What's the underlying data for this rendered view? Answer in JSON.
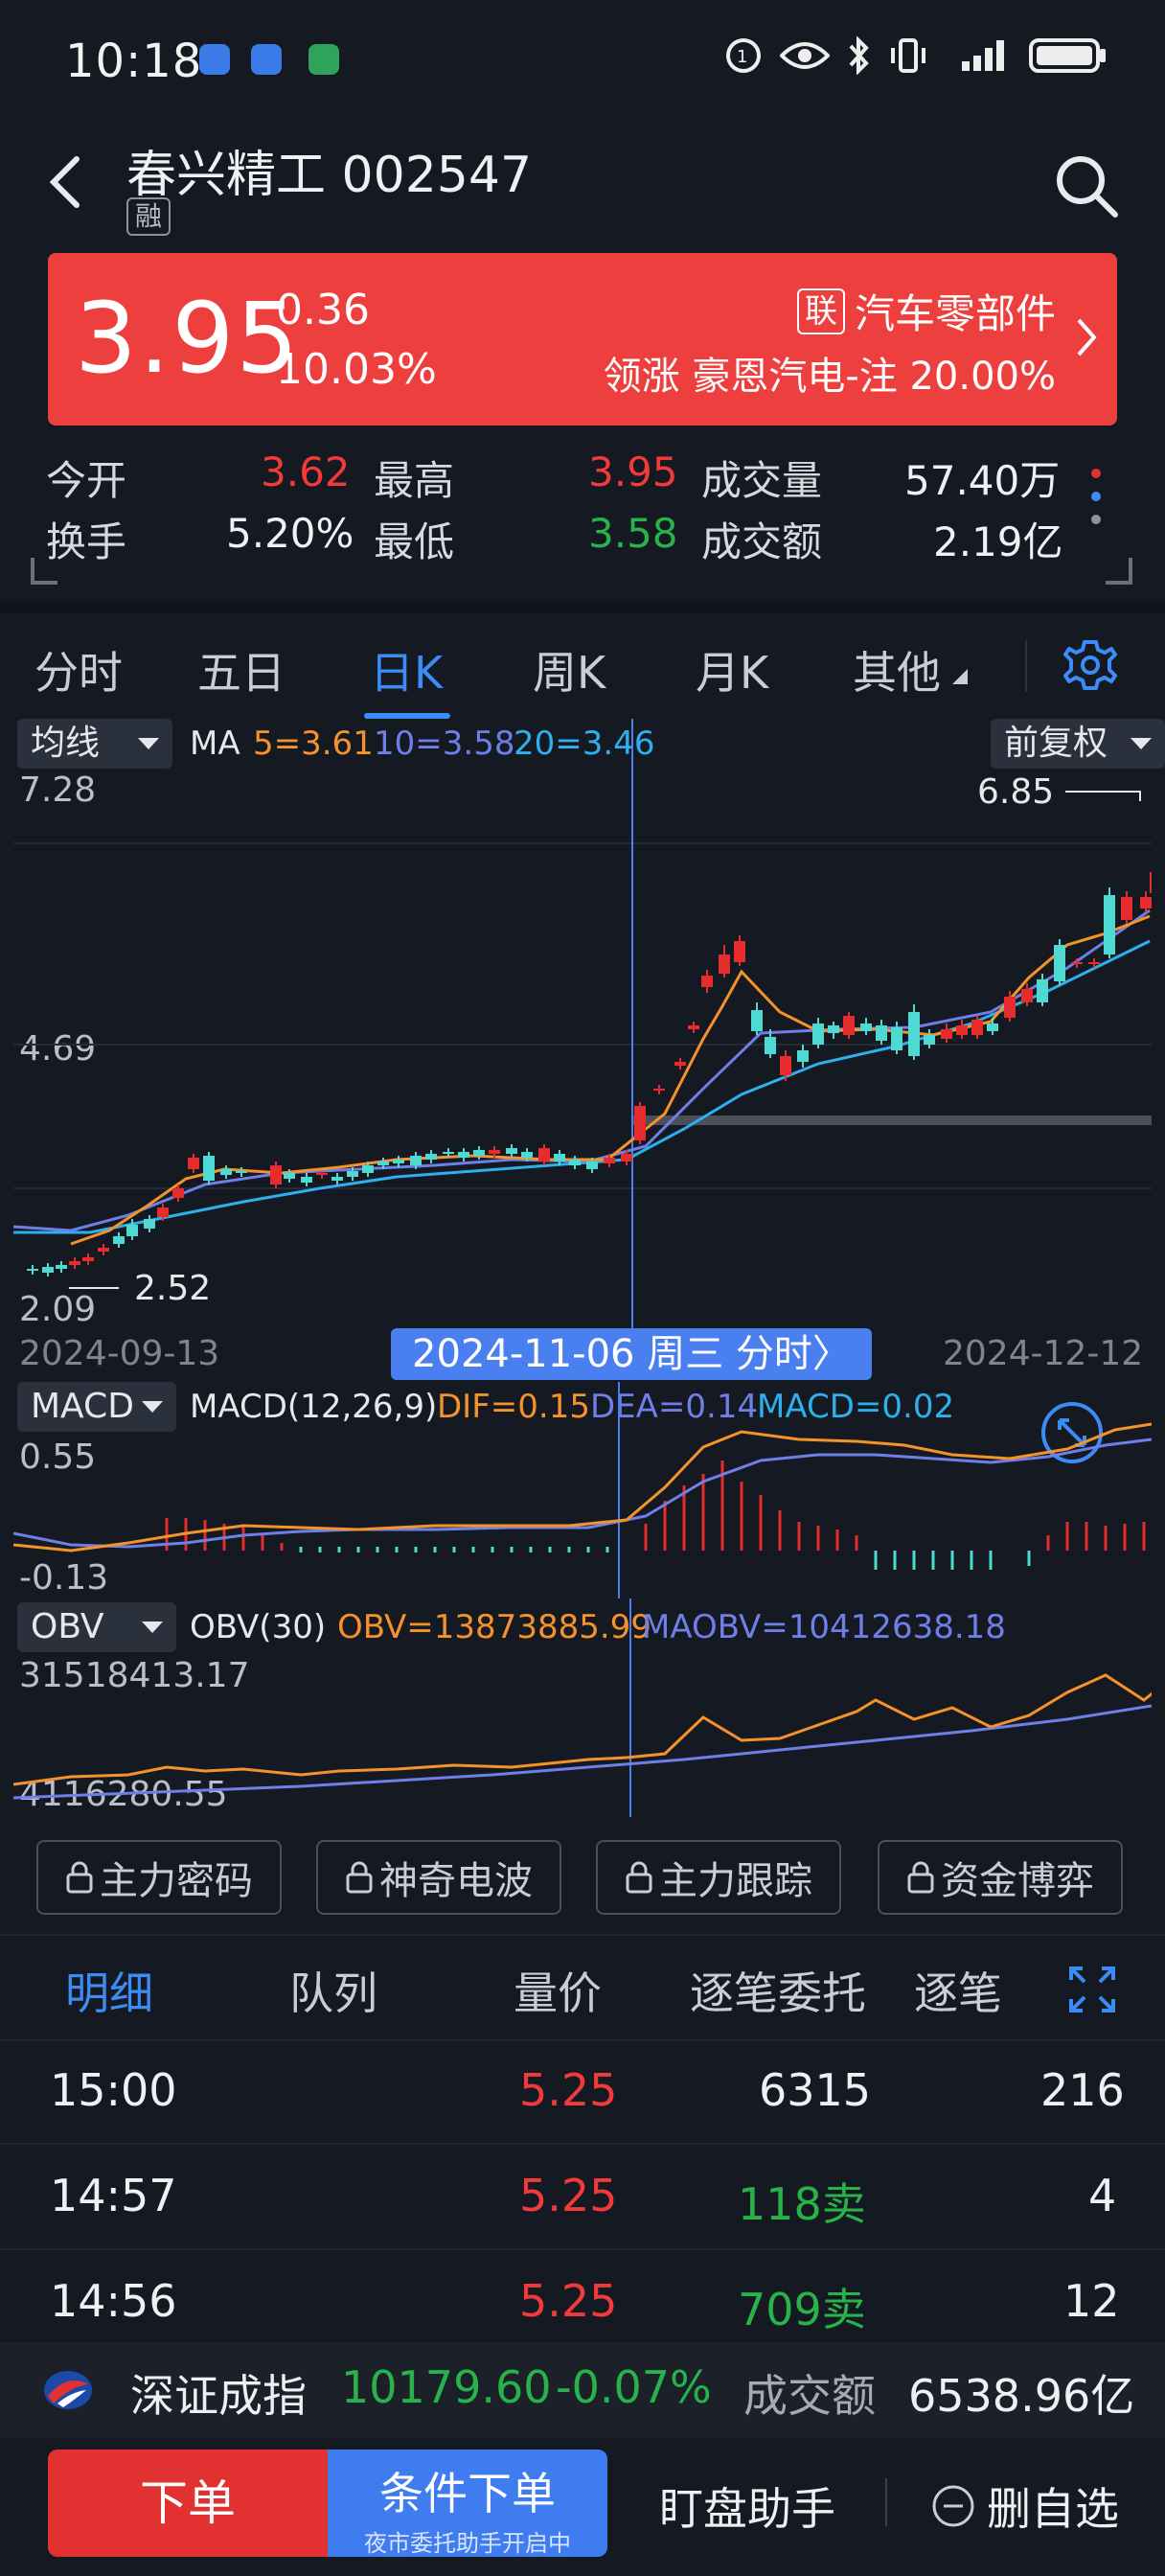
{
  "status_bar": {
    "time": "10:18"
  },
  "header": {
    "title": "春兴精工 002547",
    "tag": "融"
  },
  "banner": {
    "price": "3.95",
    "change": "0.36",
    "change_pct": "10.03%",
    "lian": "联",
    "industry": "汽车零部件",
    "lead_label": "领涨",
    "lead_text": "豪恩汽电-注 20.00%"
  },
  "stats": {
    "open_label": "今开",
    "open": "3.62",
    "high_label": "最高",
    "high": "3.95",
    "volume_label": "成交量",
    "volume": "57.40万",
    "turnover_label": "换手",
    "turnover": "5.20%",
    "low_label": "最低",
    "low": "3.58",
    "amount_label": "成交额",
    "amount": "2.19亿"
  },
  "tabs": [
    "分时",
    "五日",
    "日K",
    "周K",
    "月K",
    "其他"
  ],
  "active_tab": "日K",
  "kline": {
    "ma_select": "均线",
    "ma_label": "MA",
    "ma5": "5=3.61",
    "ma10": "10=3.58",
    "ma20": "20=3.46",
    "adjust": "前复权",
    "y_top": "7.28",
    "y_mid": "4.69",
    "y_bot": "2.09",
    "max_label": "6.85",
    "min_label": "2.52",
    "date_left": "2024-09-13",
    "date_right": "2024-12-12",
    "crosshair_date": "2024-11-06 周三 分时〉",
    "colors": {
      "ma5": "#f5922a",
      "ma10": "#6f7fe8",
      "ma20": "#2fb0ee",
      "up": "#e62d2d",
      "down": "#4fd9d2"
    }
  },
  "macd": {
    "select": "MACD",
    "params": "MACD(12,26,9)",
    "dif": "DIF=0.15",
    "dea": "DEA=0.14",
    "macd": "MACD=0.02",
    "y_top": "0.55",
    "y_bot": "-0.13"
  },
  "obv": {
    "select": "OBV",
    "params": "OBV(30)",
    "obv": "OBV=13873885.99",
    "maobv": "MAOBV=10412638.18",
    "y_top": "31518413.17",
    "y_bot": "4116280.55"
  },
  "locked_buttons": [
    "主力密码",
    "神奇电波",
    "主力跟踪",
    "资金博弈"
  ],
  "detail_tabs": [
    "明细",
    "队列",
    "量价",
    "逐笔委托",
    "逐笔"
  ],
  "trades": [
    {
      "time": "15:00",
      "price": "5.25",
      "vol": "6315",
      "count": "216"
    },
    {
      "time": "14:57",
      "price": "5.25",
      "vol": "118卖",
      "count": "4"
    },
    {
      "time": "14:56",
      "price": "5.25",
      "vol": "709卖",
      "count": "12"
    }
  ],
  "index_bar": {
    "name": "深证成指",
    "value": "10179.60",
    "change": "-0.07%",
    "amount_label": "成交额",
    "amount": "6538.96亿"
  },
  "bottom": {
    "order": "下单",
    "cond_order": "条件下单",
    "cond_sub": "夜市委托助手开启中",
    "assistant": "盯盘助手",
    "remove": "删自选"
  }
}
